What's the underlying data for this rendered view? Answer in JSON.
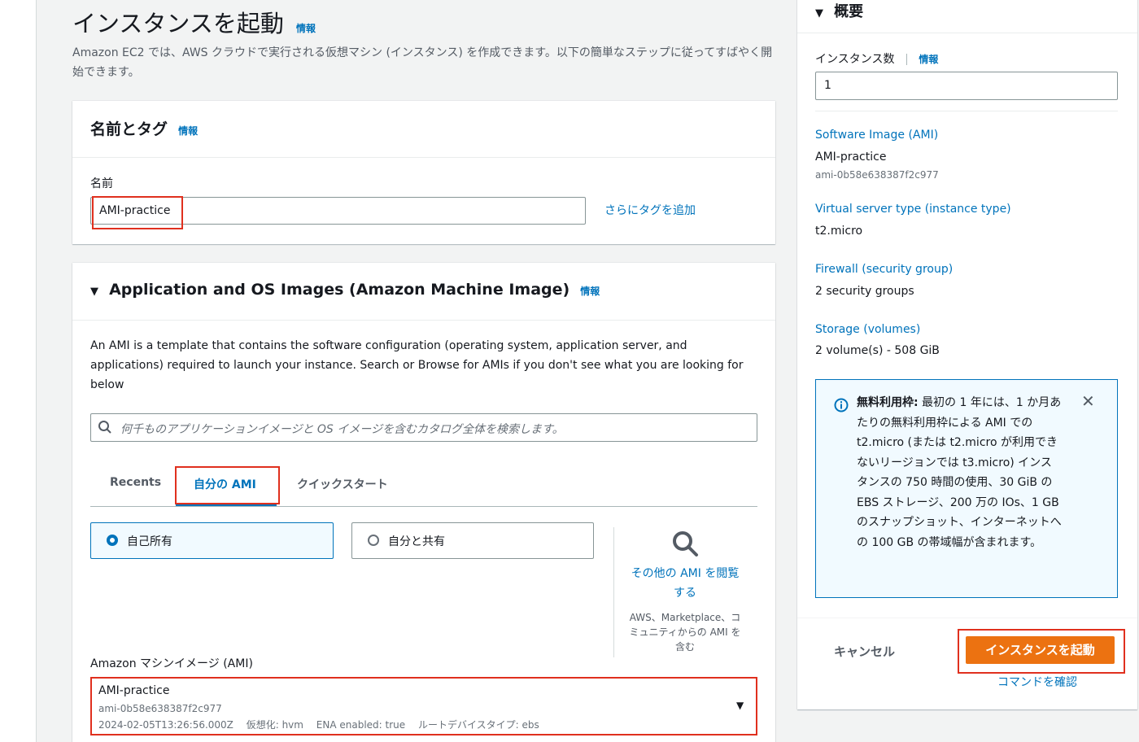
{
  "page": {
    "title": "インスタンスを起動",
    "title_info": "情報",
    "description": "Amazon EC2 では、AWS クラウドで実行される仮想マシン (インスタンス) を作成できます。以下の簡単なステップに従ってすばやく開始できます。"
  },
  "name_tags": {
    "header": "名前とタグ",
    "info": "情報",
    "name_label": "名前",
    "name_value": "AMI-practice",
    "add_tags": "さらにタグを追加"
  },
  "ami_section": {
    "header": "Application and OS Images (Amazon Machine Image)",
    "info": "情報",
    "description": "An AMI is a template that contains the software configuration (operating system, application server, and applications) required to launch your instance. Search or Browse for AMIs if you don't see what you are looking for below",
    "search_placeholder": "何千ものアプリケーションイメージと OS イメージを含むカタログ全体を検索します。",
    "tabs": [
      "Recents",
      "自分の AMI",
      "クイックスタート"
    ],
    "radio_owned": "自己所有",
    "radio_shared": "自分と共有",
    "browse_link": "その他の AMI を閲覧する",
    "browse_sub": "AWS、Marketplace、コミュニティからの AMI を含む",
    "ami_label": "Amazon マシンイメージ (AMI)",
    "selected_ami": {
      "name": "AMI-practice",
      "id": "ami-0b58e638387f2c977",
      "meta": "2024-02-05T13:26:56.000Z　 仮想化: hvm　 ENA enabled: true　 ルートデバイスタイプ: ebs"
    }
  },
  "summary": {
    "header": "概要",
    "count_label": "インスタンス数",
    "count_info": "情報",
    "count_value": "1",
    "software_label": "Software Image (AMI)",
    "software_value": "AMI-practice",
    "software_sub": "ami-0b58e638387f2c977",
    "instance_type_label": "Virtual server type (instance type)",
    "instance_type_value": "t2.micro",
    "firewall_label": "Firewall (security group)",
    "firewall_value": "2 security groups",
    "storage_label": "Storage (volumes)",
    "storage_value": "2 volume(s) - 508 GiB",
    "free_tier_bold": "無料利用枠:",
    "free_tier_text": " 最初の 1 年には、1 か月あたりの無料利用枠による AMI での t2.micro (または t2.micro が利用できないリージョンでは t3.micro) インスタンスの 750 時間の使用、30 GiB の EBS ストレージ、200 万の IOs、1 GB のスナップショット、インターネットへの 100 GB の帯域幅が含まれます。",
    "cancel": "キャンセル",
    "launch": "インスタンスを起動",
    "review_commands": "コマンドを確認"
  },
  "colors": {
    "accent_link": "#0073bb",
    "primary_button": "#ec7211",
    "highlight_border": "#e0301e",
    "info_box_bg": "#f1faff"
  }
}
